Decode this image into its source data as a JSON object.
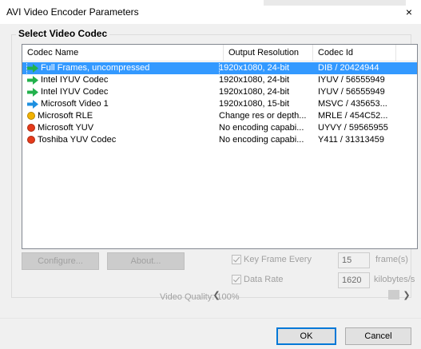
{
  "window": {
    "title": "AVI Video Encoder Parameters",
    "close_glyph": "×"
  },
  "group": {
    "label": "Select Video Codec"
  },
  "columns": [
    "Codec Name",
    "Output Resolution",
    "Codec Id"
  ],
  "codecs": [
    {
      "name": "Full Frames, uncompressed",
      "resolution": "1920x1080, 24-bit",
      "id": "DIB  / 20424944",
      "icon": "green-arrow-icon",
      "selected": true
    },
    {
      "name": "Intel IYUV Codec",
      "resolution": "1920x1080, 24-bit",
      "id": "IYUV / 56555949",
      "icon": "green-arrow-icon",
      "selected": false
    },
    {
      "name": "Intel IYUV Codec",
      "resolution": "1920x1080, 24-bit",
      "id": "IYUV / 56555949",
      "icon": "green-arrow-icon",
      "selected": false
    },
    {
      "name": "Microsoft Video 1",
      "resolution": "1920x1080, 15-bit",
      "id": "MSVC / 435653...",
      "icon": "blue-arrow-icon",
      "selected": false
    },
    {
      "name": "Microsoft RLE",
      "resolution": "Change res or depth...",
      "id": "MRLE / 454C52...",
      "icon": "yellow-dot-icon",
      "selected": false
    },
    {
      "name": "Microsoft YUV",
      "resolution": "No encoding capabi...",
      "id": "UYVY / 59565955",
      "icon": "red-dot-icon",
      "selected": false
    },
    {
      "name": "Toshiba YUV Codec",
      "resolution": "No encoding capabi...",
      "id": "Y411 / 31313459",
      "icon": "red-dot-icon",
      "selected": false
    }
  ],
  "buttons": {
    "configure": "Configure...",
    "about": "About...",
    "ok": "OK",
    "cancel": "Cancel"
  },
  "options": {
    "key_frame_label": "Key Frame Every",
    "key_frame_value": "15",
    "key_frame_unit": "frame(s)",
    "data_rate_label": "Data Rate",
    "data_rate_value": "1620",
    "data_rate_unit": "kilobytes/s",
    "quality_label": "Video Quality: 100%",
    "quality_percent": 100
  },
  "colors": {
    "selection": "#3399ff",
    "green_arrow": "#22b14c",
    "blue_arrow": "#1e90e0",
    "yellow_dot": "#f2b200",
    "red_dot": "#e53a1a",
    "default_button_border": "#0078d7"
  }
}
